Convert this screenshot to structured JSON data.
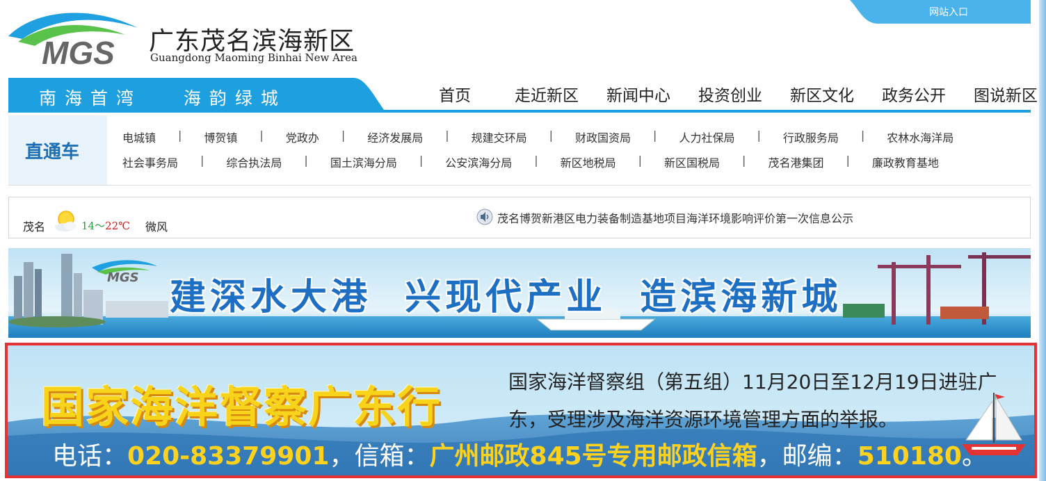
{
  "header": {
    "logo_text": "MGS",
    "site_title": "广东茂名滨海新区",
    "site_subtitle": "Guangdong Maoming Binhai New Area",
    "portal_link": "网站入口",
    "colors": {
      "primary_blue": "#1d9fe0",
      "accent_green": "#2a9a3a"
    }
  },
  "nav": {
    "slogan": "南海首湾   海韵绿城",
    "items": [
      {
        "label": "首页"
      },
      {
        "label": "走近新区"
      },
      {
        "label": "新闻中心"
      },
      {
        "label": "投资创业"
      },
      {
        "label": "新区文化"
      },
      {
        "label": "政务公开"
      },
      {
        "label": "图说新区"
      }
    ]
  },
  "quick_links": {
    "label": "直通车",
    "separator": "|",
    "row1": [
      "电城镇",
      "博贺镇",
      "党政办",
      "经济发展局",
      "规建交环局",
      "财政国资局",
      "人力社保局",
      "行政服务局",
      "农林水海洋局"
    ],
    "row2": [
      "社会事务局",
      "综合执法局",
      "国土滨海分局",
      "公安滨海分局",
      "新区地税局",
      "新区国税局",
      "茂名港集团",
      "廉政教育基地"
    ]
  },
  "info_bar": {
    "city": "茂名",
    "weather_icon": "sun-cloud-icon",
    "temp_low": "14",
    "temp_sep": "～",
    "temp_high": "22℃",
    "wind": "微风",
    "news_icon": "speaker-icon",
    "news": "茂名博贺新港区电力装备制造基地项目海洋环境影响评价第一次信息公示"
  },
  "banner1": {
    "logo_text": "MGS",
    "slogan": "建深水大港  兴现代产业  造滨海新城"
  },
  "banner2": {
    "title": "国家海洋督察广东行",
    "notice": "国家海洋督察组（第五组）11月20日至12月19日进驻广东，受理涉及海洋资源环境管理方面的举报。",
    "phone_label": "电话：",
    "phone": "020-83379901",
    "mail_label": "，信箱：",
    "mailbox": "广州邮政845号专用邮政信箱",
    "zip_label": "，邮编：",
    "zip": "510180",
    "end": "。"
  }
}
